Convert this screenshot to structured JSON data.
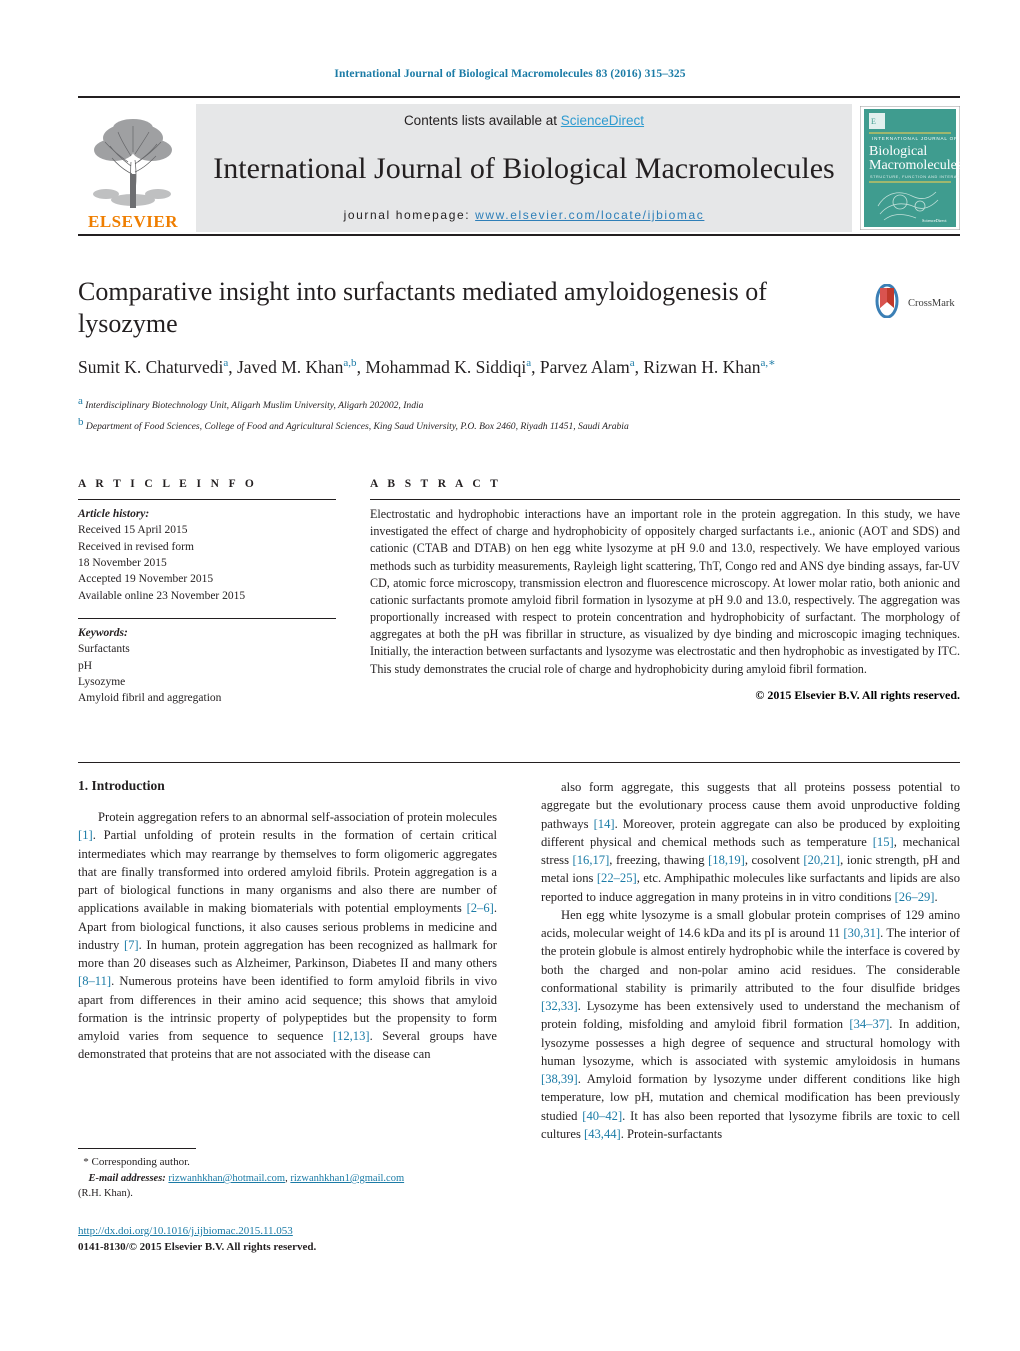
{
  "running_head": "International Journal of Biological Macromolecules 83 (2016) 315–325",
  "masthead": {
    "contents_prefix": "Contents lists available at ",
    "sciencedirect": "ScienceDirect",
    "journal_title": "International Journal of Biological Macromolecules",
    "homepage_label": "journal homepage: ",
    "homepage_url": "www.elsevier.com/locate/ijbiomac",
    "publisher": "ELSEVIER",
    "cover": {
      "kicker": "INTERNATIONAL JOURNAL OF",
      "line1": "Biological",
      "line2": "Macromolecules",
      "subtitle": "STRUCTURE, FUNCTION AND INTERACTIONS",
      "footer": "ScienceDirect"
    },
    "colors": {
      "link_blue": "#2e9bd0",
      "url_blue": "#2e7fb8",
      "elsevier_orange": "#ef7e00",
      "cover_teal": "#3f9c8f",
      "panel_grey": "#e6e7e8"
    }
  },
  "article": {
    "title": "Comparative insight into surfactants mediated amyloidogenesis of lysozyme",
    "authors_html": "Sumit K. Chaturvedi<sup>a</sup>, Javed M. Khan<sup>a,b</sup>, Mohammad K. Siddiqi<sup>a</sup>, Parvez Alam<sup>a</sup>, Rizwan H. Khan<sup>a,∗</sup>",
    "affiliation_a": "Interdisciplinary Biotechnology Unit, Aligarh Muslim University, Aligarh 202002, India",
    "affiliation_b": "Department of Food Sciences, College of Food and Agricultural Sciences, King Saud University, P.O. Box 2460, Riyadh 11451, Saudi Arabia",
    "crossmark_label": "CrossMark"
  },
  "article_info": {
    "heading": "A R T I C L E    I N F O",
    "history_label": "Article history:",
    "history": [
      "Received 15 April 2015",
      "Received in revised form",
      "18 November 2015",
      "Accepted 19 November 2015",
      "Available online 23 November 2015"
    ],
    "keywords_label": "Keywords:",
    "keywords": [
      "Surfactants",
      "pH",
      "Lysozyme",
      "Amyloid fibril and aggregation"
    ]
  },
  "abstract": {
    "heading": "A B S T R A C T",
    "text": "Electrostatic and hydrophobic interactions have an important role in the protein aggregation. In this study, we have investigated the effect of charge and hydrophobicity of oppositely charged surfactants i.e., anionic (AOT and SDS) and cationic (CTAB and DTAB) on hen egg white lysozyme at pH 9.0 and 13.0, respectively. We have employed various methods such as turbidity measurements, Rayleigh light scattering, ThT, Congo red and ANS dye binding assays, far-UV CD, atomic force microscopy, transmission electron and fluorescence microscopy. At lower molar ratio, both anionic and cationic surfactants promote amyloid fibril formation in lysozyme at pH 9.0 and 13.0, respectively. The aggregation was proportionally increased with respect to protein concentration and hydrophobicity of surfactant. The morphology of aggregates at both the pH was fibrillar in structure, as visualized by dye binding and microscopic imaging techniques. Initially, the interaction between surfactants and lysozyme was electrostatic and then hydrophobic as investigated by ITC. This study demonstrates the crucial role of charge and hydrophobicity during amyloid fibril formation.",
    "copyright": "© 2015 Elsevier B.V. All rights reserved."
  },
  "body": {
    "section_number_title": "1.  Introduction",
    "left_paragraph_1_html": "Protein aggregation refers to an abnormal self-association of protein molecules <span class=\"ref\">[1]</span>. Partial unfolding of protein results in the formation of certain critical intermediates which may rearrange by themselves to form oligomeric aggregates that are finally transformed into ordered amyloid fibrils. Protein aggregation is a part of biological functions in many organisms and also there are number of applications available in making biomaterials with potential employments <span class=\"ref\">[2–6]</span>. Apart from biological functions, it also causes serious problems in medicine and industry <span class=\"ref\">[7]</span>. In human, protein aggregation has been recognized as hallmark for more than 20 diseases such as Alzheimer, Parkinson, Diabetes II and many others <span class=\"ref\">[8–11]</span>. Numerous proteins have been identified to form amyloid fibrils in vivo apart from differences in their amino acid sequence; this shows that amyloid formation is the intrinsic property of polypeptides but the propensity to form amyloid varies from sequence to sequence <span class=\"ref\">[12,13]</span>. Several groups have demonstrated that proteins that are not associated with the disease can",
    "right_paragraph_1_html": "also form aggregate, this suggests that all proteins possess potential to aggregate but the evolutionary process cause them avoid unproductive folding pathways <span class=\"ref\">[14]</span>. Moreover, protein aggregate can also be produced by exploiting different physical and chemical methods such as temperature <span class=\"ref\">[15]</span>, mechanical stress <span class=\"ref\">[16,17]</span>, freezing, thawing <span class=\"ref\">[18,19]</span>, cosolvent <span class=\"ref\">[20,21]</span>, ionic strength, pH and metal ions <span class=\"ref\">[22–25]</span>, etc. Amphipathic molecules like surfactants and lipids are also reported to induce aggregation in many proteins in in vitro conditions <span class=\"ref\">[26–29]</span>.",
    "right_paragraph_2_html": "Hen egg white lysozyme is a small globular protein comprises of 129 amino acids, molecular weight of 14.6 kDa and its pI is around 11 <span class=\"ref\">[30,31]</span>. The interior of the protein globule is almost entirely hydrophobic while the interface is covered by both the charged and non-polar amino acid residues. The considerable conformational stability is primarily attributed to the four disulfide bridges <span class=\"ref\">[32,33]</span>. Lysozyme has been extensively used to understand the mechanism of protein folding, misfolding and amyloid fibril formation <span class=\"ref\">[34–37]</span>. In addition, lysozyme possesses a high degree of sequence and structural homology with human lysozyme, which is associated with systemic amyloidosis in humans <span class=\"ref\">[38,39]</span>. Amyloid formation by lysozyme under different conditions like high temperature, low pH, mutation and chemical modification has been previously studied <span class=\"ref\">[40–42]</span>. It has also been reported that lysozyme fibrils are toxic to cell cultures <span class=\"ref\">[43,44]</span>. Protein-surfactants"
  },
  "footnotes": {
    "corresponding": "* Corresponding author.",
    "email_label": "E-mail addresses:",
    "email_1": "rizwanhkhan@hotmail.com",
    "email_separator": ", ",
    "email_2": "rizwanhkhan1@gmail.com",
    "email_owner": "(R.H. Khan).",
    "doi": "http://dx.doi.org/10.1016/j.ijbiomac.2015.11.053",
    "issn_line": "0141-8130/© 2015 Elsevier B.V. All rights reserved."
  }
}
